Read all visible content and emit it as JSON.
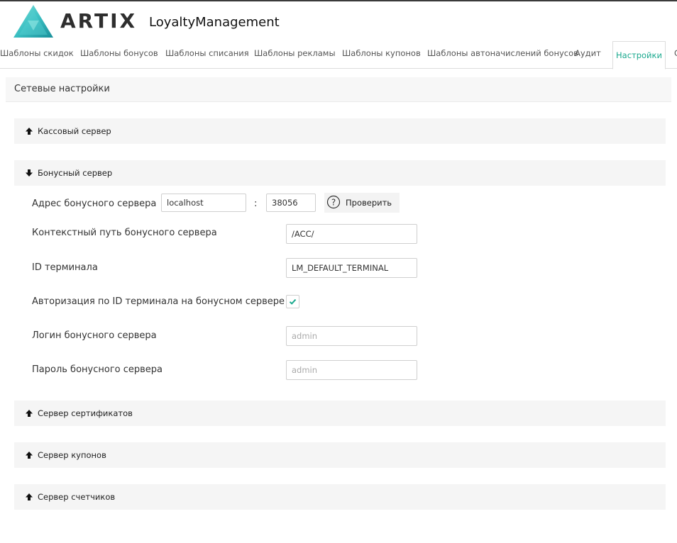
{
  "header": {
    "brand": "ARTIX",
    "app_name": "LoyaltyManagement"
  },
  "tabs": [
    {
      "label": "Шаблоны скидок"
    },
    {
      "label": "Шаблоны бонусов"
    },
    {
      "label": "Шаблоны списания"
    },
    {
      "label": "Шаблоны рекламы"
    },
    {
      "label": "Шаблоны купонов"
    },
    {
      "label": "Шаблоны автоначислений бонусов"
    },
    {
      "label": "Аудит"
    },
    {
      "label": "Настройки",
      "active": true
    },
    {
      "label": "С"
    }
  ],
  "panel": {
    "title": "Сетевые настройки"
  },
  "sections": {
    "cash_server": {
      "title": "Кассовый сервер",
      "icon": "arrow-up-icon"
    },
    "bonus_server": {
      "title": "Бонусный сервер",
      "icon": "arrow-down-icon"
    },
    "cert_server": {
      "title": "Сервер сертификатов",
      "icon": "arrow-up-icon"
    },
    "coupon_server": {
      "title": "Сервер купонов",
      "icon": "arrow-up-icon"
    },
    "counter_server": {
      "title": "Сервер счетчиков",
      "icon": "arrow-up-icon"
    }
  },
  "bonus_form": {
    "address_label": "Адрес бонусного сервера",
    "host_value": "localhost",
    "separator": ":",
    "port_value": "38056",
    "check_button": "Проверить",
    "context_label": "Контекстный путь бонусного сервера",
    "context_value": "/ACC/",
    "terminal_label": "ID терминала",
    "terminal_value": "LM_DEFAULT_TERMINAL",
    "auth_label": "Авторизация по ID терминала на бонусном сервере",
    "auth_checked": true,
    "login_label": "Логин бонусного сервера",
    "login_placeholder": "admin",
    "password_label": "Пароль бонусного сервера",
    "password_placeholder": "admin"
  },
  "colors": {
    "accent": "#1aa98e",
    "section_bg": "#f5f5f5",
    "border": "#dddddd"
  }
}
